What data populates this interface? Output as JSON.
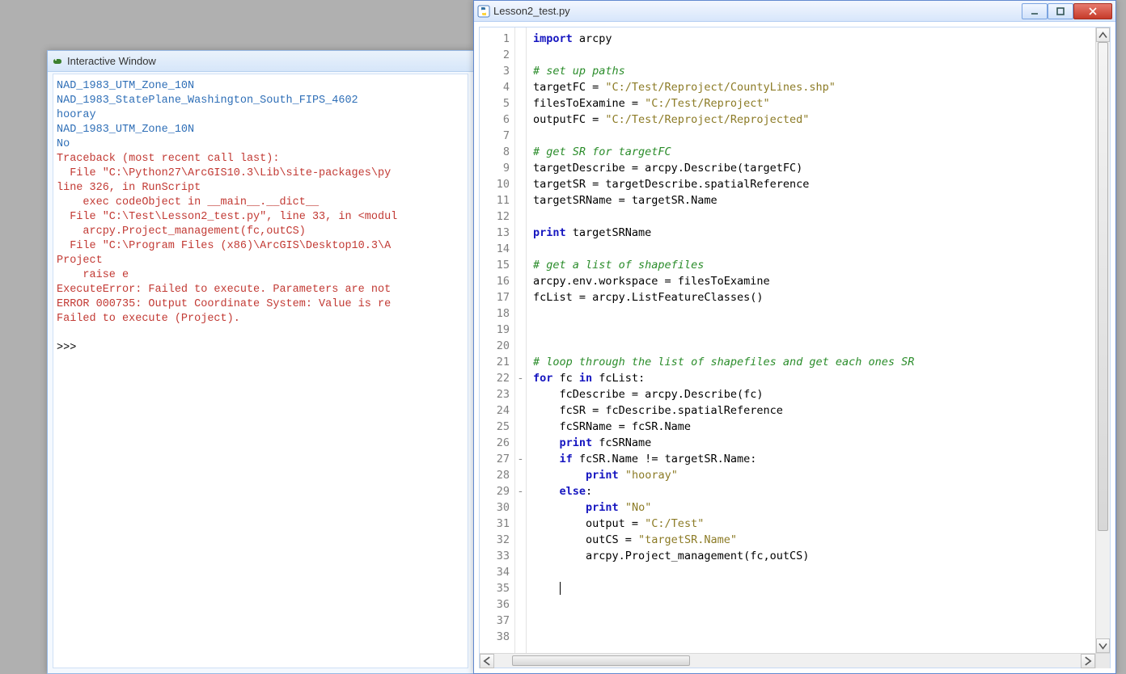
{
  "interactive": {
    "title": "Interactive Window",
    "lines": [
      {
        "cls": "con-blue",
        "text": "NAD_1983_UTM_Zone_10N"
      },
      {
        "cls": "con-blue",
        "text": "NAD_1983_StatePlane_Washington_South_FIPS_4602"
      },
      {
        "cls": "con-blue",
        "text": "hooray"
      },
      {
        "cls": "con-blue",
        "text": "NAD_1983_UTM_Zone_10N"
      },
      {
        "cls": "con-blue",
        "text": "No"
      },
      {
        "cls": "con-red",
        "text": "Traceback (most recent call last):"
      },
      {
        "cls": "con-red",
        "text": "  File \"C:\\Python27\\ArcGIS10.3\\Lib\\site-packages\\py"
      },
      {
        "cls": "con-red",
        "text": "line 326, in RunScript"
      },
      {
        "cls": "con-red",
        "text": "    exec codeObject in __main__.__dict__"
      },
      {
        "cls": "con-red",
        "text": "  File \"C:\\Test\\Lesson2_test.py\", line 33, in <modul"
      },
      {
        "cls": "con-red",
        "text": "    arcpy.Project_management(fc,outCS)"
      },
      {
        "cls": "con-red",
        "text": "  File \"C:\\Program Files (x86)\\ArcGIS\\Desktop10.3\\A"
      },
      {
        "cls": "con-red",
        "text": "Project"
      },
      {
        "cls": "con-red",
        "text": "    raise e"
      },
      {
        "cls": "con-red",
        "text": "ExecuteError: Failed to execute. Parameters are not"
      },
      {
        "cls": "con-red",
        "text": "ERROR 000735: Output Coordinate System: Value is re"
      },
      {
        "cls": "con-red",
        "text": "Failed to execute (Project)."
      },
      {
        "cls": "con-black",
        "text": ""
      },
      {
        "cls": "con-black",
        "text": ">>>"
      }
    ]
  },
  "editor": {
    "title": "Lesson2_test.py",
    "line_count": 38,
    "fold_marks": {
      "22": "-",
      "27": "-",
      "29": "-"
    },
    "code": [
      [
        {
          "k": "kw",
          "t": "import"
        },
        {
          "t": " arcpy"
        }
      ],
      [],
      [
        {
          "k": "cm",
          "t": "# set up paths"
        }
      ],
      [
        {
          "t": "targetFC = "
        },
        {
          "k": "st",
          "t": "\"C:/Test/Reproject/CountyLines.shp\""
        }
      ],
      [
        {
          "t": "filesToExamine = "
        },
        {
          "k": "st",
          "t": "\"C:/Test/Reproject\""
        }
      ],
      [
        {
          "t": "outputFC = "
        },
        {
          "k": "st",
          "t": "\"C:/Test/Reproject/Reprojected\""
        }
      ],
      [],
      [
        {
          "k": "cm",
          "t": "# get SR for targetFC"
        }
      ],
      [
        {
          "t": "targetDescribe = arcpy.Describe(targetFC)"
        }
      ],
      [
        {
          "t": "targetSR = targetDescribe.spatialReference"
        }
      ],
      [
        {
          "t": "targetSRName = targetSR.Name"
        }
      ],
      [],
      [
        {
          "k": "kw",
          "t": "print"
        },
        {
          "t": " targetSRName"
        }
      ],
      [],
      [
        {
          "k": "cm",
          "t": "# get a list of shapefiles"
        }
      ],
      [
        {
          "t": "arcpy.env.workspace = filesToExamine"
        }
      ],
      [
        {
          "t": "fcList = arcpy.ListFeatureClasses()"
        }
      ],
      [],
      [],
      [],
      [
        {
          "k": "cm",
          "t": "# loop through the list of shapefiles and get each ones SR"
        }
      ],
      [
        {
          "k": "kw",
          "t": "for"
        },
        {
          "t": " fc "
        },
        {
          "k": "kw",
          "t": "in"
        },
        {
          "t": " fcList:"
        }
      ],
      [
        {
          "t": "    fcDescribe = arcpy.Describe(fc)"
        }
      ],
      [
        {
          "t": "    fcSR = fcDescribe.spatialReference"
        }
      ],
      [
        {
          "t": "    fcSRName = fcSR.Name"
        }
      ],
      [
        {
          "t": "    "
        },
        {
          "k": "kw",
          "t": "print"
        },
        {
          "t": " fcSRName"
        }
      ],
      [
        {
          "t": "    "
        },
        {
          "k": "kw",
          "t": "if"
        },
        {
          "t": " fcSR.Name != targetSR.Name:"
        }
      ],
      [
        {
          "t": "        "
        },
        {
          "k": "kw",
          "t": "print"
        },
        {
          "t": " "
        },
        {
          "k": "st",
          "t": "\"hooray\""
        }
      ],
      [
        {
          "t": "    "
        },
        {
          "k": "kw",
          "t": "else"
        },
        {
          "t": ":"
        }
      ],
      [
        {
          "t": "        "
        },
        {
          "k": "kw",
          "t": "print"
        },
        {
          "t": " "
        },
        {
          "k": "st",
          "t": "\"No\""
        }
      ],
      [
        {
          "t": "        output = "
        },
        {
          "k": "st",
          "t": "\"C:/Test\""
        }
      ],
      [
        {
          "t": "        outCS = "
        },
        {
          "k": "st",
          "t": "\"targetSR.Name\""
        }
      ],
      [
        {
          "t": "        arcpy.Project_management(fc,outCS)"
        }
      ],
      [],
      [
        {
          "t": "    "
        },
        {
          "k": "caret"
        }
      ],
      [],
      [],
      []
    ]
  }
}
